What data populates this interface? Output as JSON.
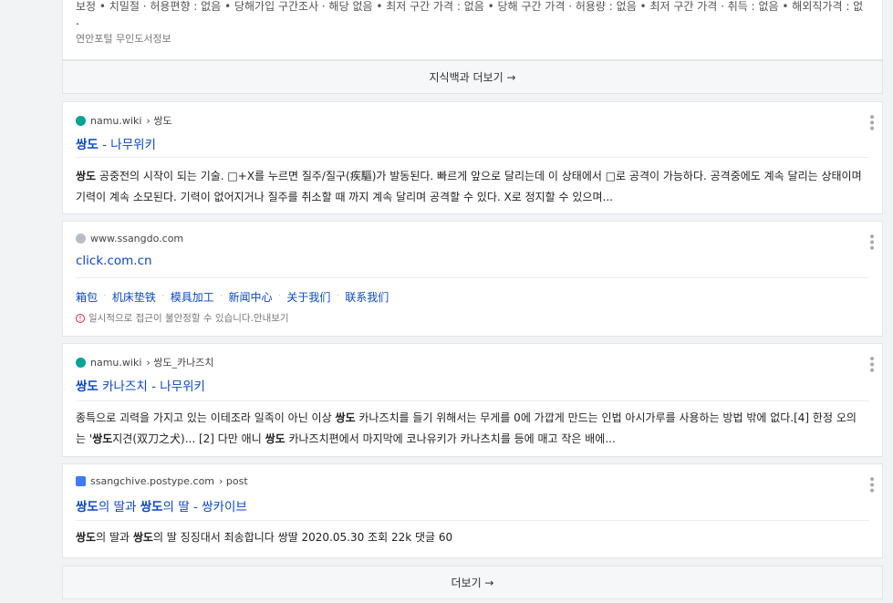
{
  "top_card": {
    "cut_text": "보정 • 치밀절 · 허용편향 : 없음 • 당해가입 구간조사 · 해당 없음 • 최저 구간 가격 : 없음 • 당해 구간 가격 · 허용량 : 없음 • 최저 구간 가격 · 취득 : 없음 • 해외직가격 : 없음..",
    "dot": ".",
    "source": "연안포털 무인도서정보"
  },
  "knowledge_more": "지식백과 더보기 →",
  "results": [
    {
      "site": "namu.wiki",
      "path": "› 쌍도",
      "title_bold": "쌍도",
      "title_rest": " - 나무위키",
      "desc_bold": "쌍도",
      "desc": " 공중전의 시작이 되는 기술. □+X를 누르면 질주/질구(疾驅)가 발동된다. 빠르게 앞으로 달리는데 이 상태에서 □로 공격이 가능하다. 공격중에도 계속 달리는 상태이며 기력이 계속 소모된다. 기력이 없어지거나 질주를 취소할 때 까지 계속 달리며 공격할 수 있다. X로 정지할 수 있으며..."
    },
    {
      "site": "www.ssangdo.com",
      "title": "click.com.cn",
      "links": [
        "箱包",
        "机床垫铁",
        "模具加工",
        "新闻中心",
        "关于我们",
        "联系我们"
      ],
      "warning": "일시적으로 접근이 불안정할 수 있습니다.안내보기"
    },
    {
      "site": "namu.wiki",
      "path": "› 쌍도_카나즈치",
      "title_bold": "쌍도",
      "title_rest": " 카나즈치 - 나무위키",
      "desc_a": "종특으로 괴력을 가지고 있는 이테조라 일족이 아닌 이상 ",
      "desc_bold1": "쌍도",
      "desc_b": " 카나즈치를 들기 위해서는 무게를 0에 가깝게 만드는 인법 아시가루를 사용하는 방법 밖에 없다.[4] 한정 오의는 '",
      "desc_bold2": "쌍도",
      "desc_c": "지견(双刀之犬)... [2] 다만 애니 ",
      "desc_bold3": "쌍도",
      "desc_d": " 카나즈치편에서 마지막에 코나유키가 카나츠치를 등에 매고 작은 배에..."
    },
    {
      "site": "ssangchive.postype.com",
      "path": "› post",
      "title_bold1": "쌍도",
      "title_a": "의 딸과 ",
      "title_bold2": "쌍도",
      "title_b": "의 딸 - 쌍카이브",
      "desc_bold1": "쌍도",
      "desc_a": "의 딸과 ",
      "desc_bold2": "쌍도",
      "desc_b": "의 딸 징징대서 죄송합니다 쌍딸 2020.05.30 조회 22k 댓글 60"
    }
  ],
  "more": "더보기 →",
  "colors": {
    "link": "#0a48c8",
    "namu": "#00a495",
    "postype": "#3d7bf7"
  }
}
